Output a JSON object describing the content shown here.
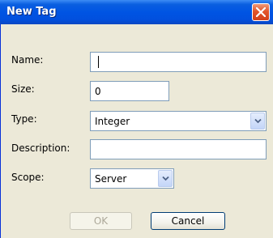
{
  "window": {
    "title": "New Tag",
    "close_icon": "close-x-icon"
  },
  "form": {
    "name": {
      "label": "Name:",
      "value": ""
    },
    "size": {
      "label": "Size:",
      "value": "0"
    },
    "type": {
      "label": "Type:",
      "value": "Integer"
    },
    "description": {
      "label": "Description:",
      "value": ""
    },
    "scope": {
      "label": "Scope:",
      "value": "Server"
    }
  },
  "buttons": {
    "ok": {
      "label": "OK",
      "enabled": false
    },
    "cancel": {
      "label": "Cancel",
      "enabled": true
    }
  },
  "colors": {
    "titlebar": "#0054e3",
    "close_button": "#e2552b",
    "dialog_bg": "#ece9d8"
  }
}
